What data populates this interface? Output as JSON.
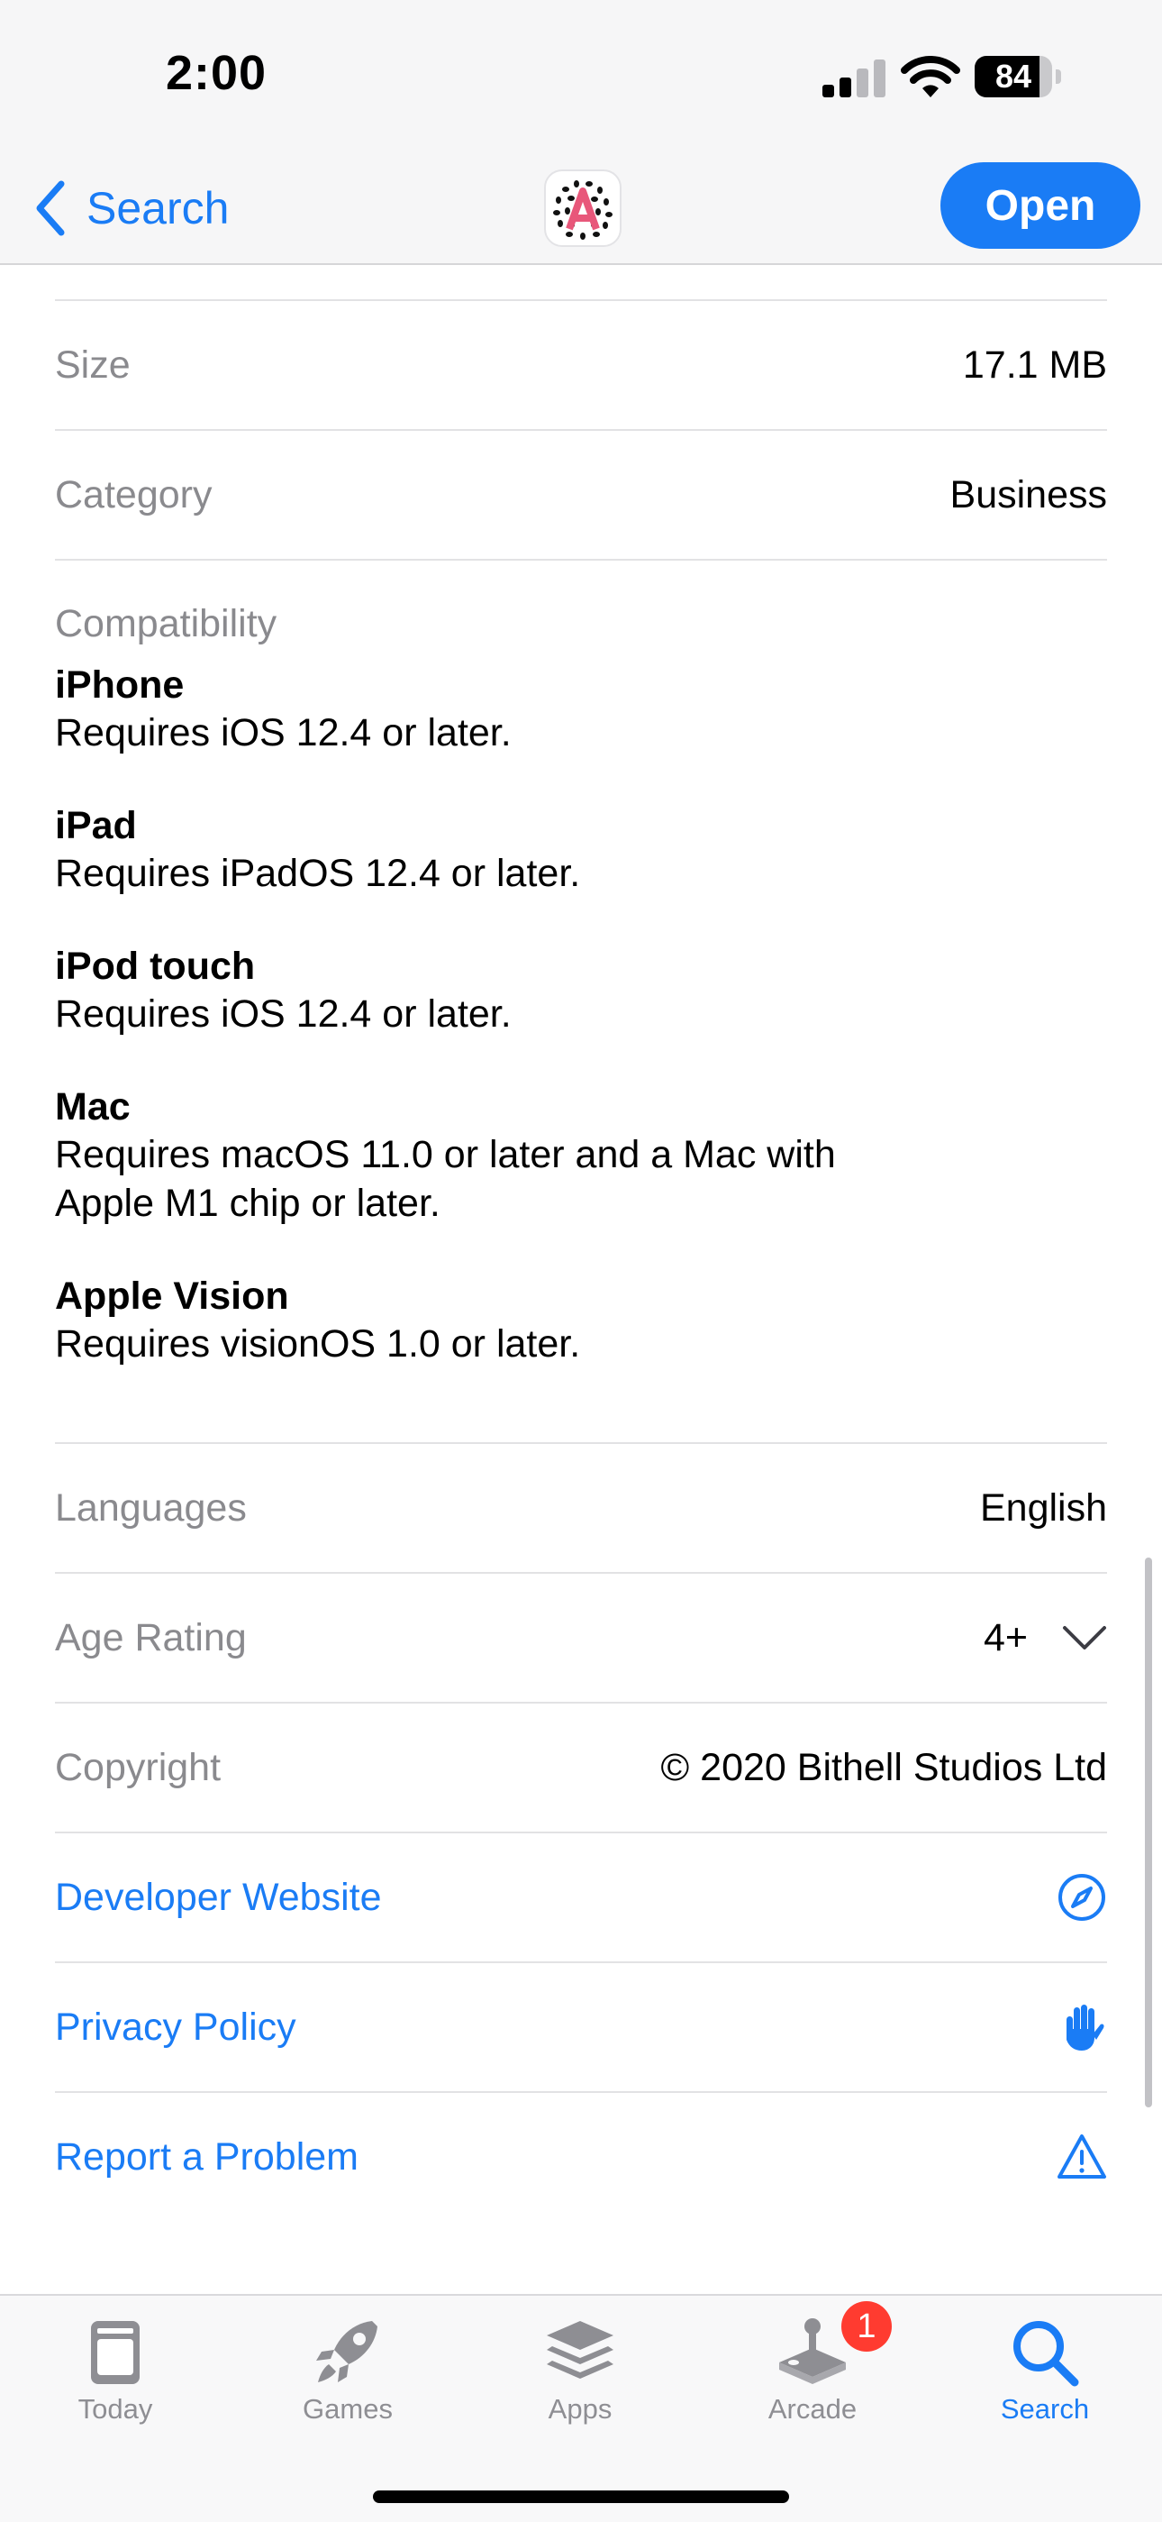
{
  "status_bar": {
    "time": "2:00",
    "battery": "84",
    "battery_level_percent": 84
  },
  "nav": {
    "back_label": "Search",
    "open_label": "Open"
  },
  "info": {
    "size": {
      "label": "Size",
      "value": "17.1 MB"
    },
    "category": {
      "label": "Category",
      "value": "Business"
    },
    "compatibility": {
      "title": "Compatibility",
      "devices": [
        {
          "name": "iPhone",
          "requirement": "Requires iOS 12.4 or later."
        },
        {
          "name": "iPad",
          "requirement": "Requires iPadOS 12.4 or later."
        },
        {
          "name": "iPod touch",
          "requirement": "Requires iOS 12.4 or later."
        },
        {
          "name": "Mac",
          "requirement": "Requires macOS 11.0 or later and a Mac with Apple M1 chip or later."
        },
        {
          "name": "Apple Vision",
          "requirement": "Requires visionOS 1.0 or later."
        }
      ]
    },
    "languages": {
      "label": "Languages",
      "value": "English"
    },
    "age_rating": {
      "label": "Age Rating",
      "value": "4+"
    },
    "copyright": {
      "label": "Copyright",
      "value": "© 2020 Bithell Studios Ltd"
    }
  },
  "links": {
    "developer_website": "Developer Website",
    "privacy_policy": "Privacy Policy",
    "report_problem": "Report a Problem"
  },
  "tabs": [
    {
      "label": "Today",
      "icon": "today-icon"
    },
    {
      "label": "Games",
      "icon": "rocket-icon"
    },
    {
      "label": "Apps",
      "icon": "apps-stack-icon"
    },
    {
      "label": "Arcade",
      "icon": "joystick-icon",
      "badge": "1"
    },
    {
      "label": "Search",
      "icon": "search-icon",
      "active": true
    }
  ],
  "colors": {
    "accent": "#1a7cf5",
    "secondary_text": "#8a8a8e",
    "badge": "#ff3b30",
    "app_icon_accent": "#e8577a"
  }
}
